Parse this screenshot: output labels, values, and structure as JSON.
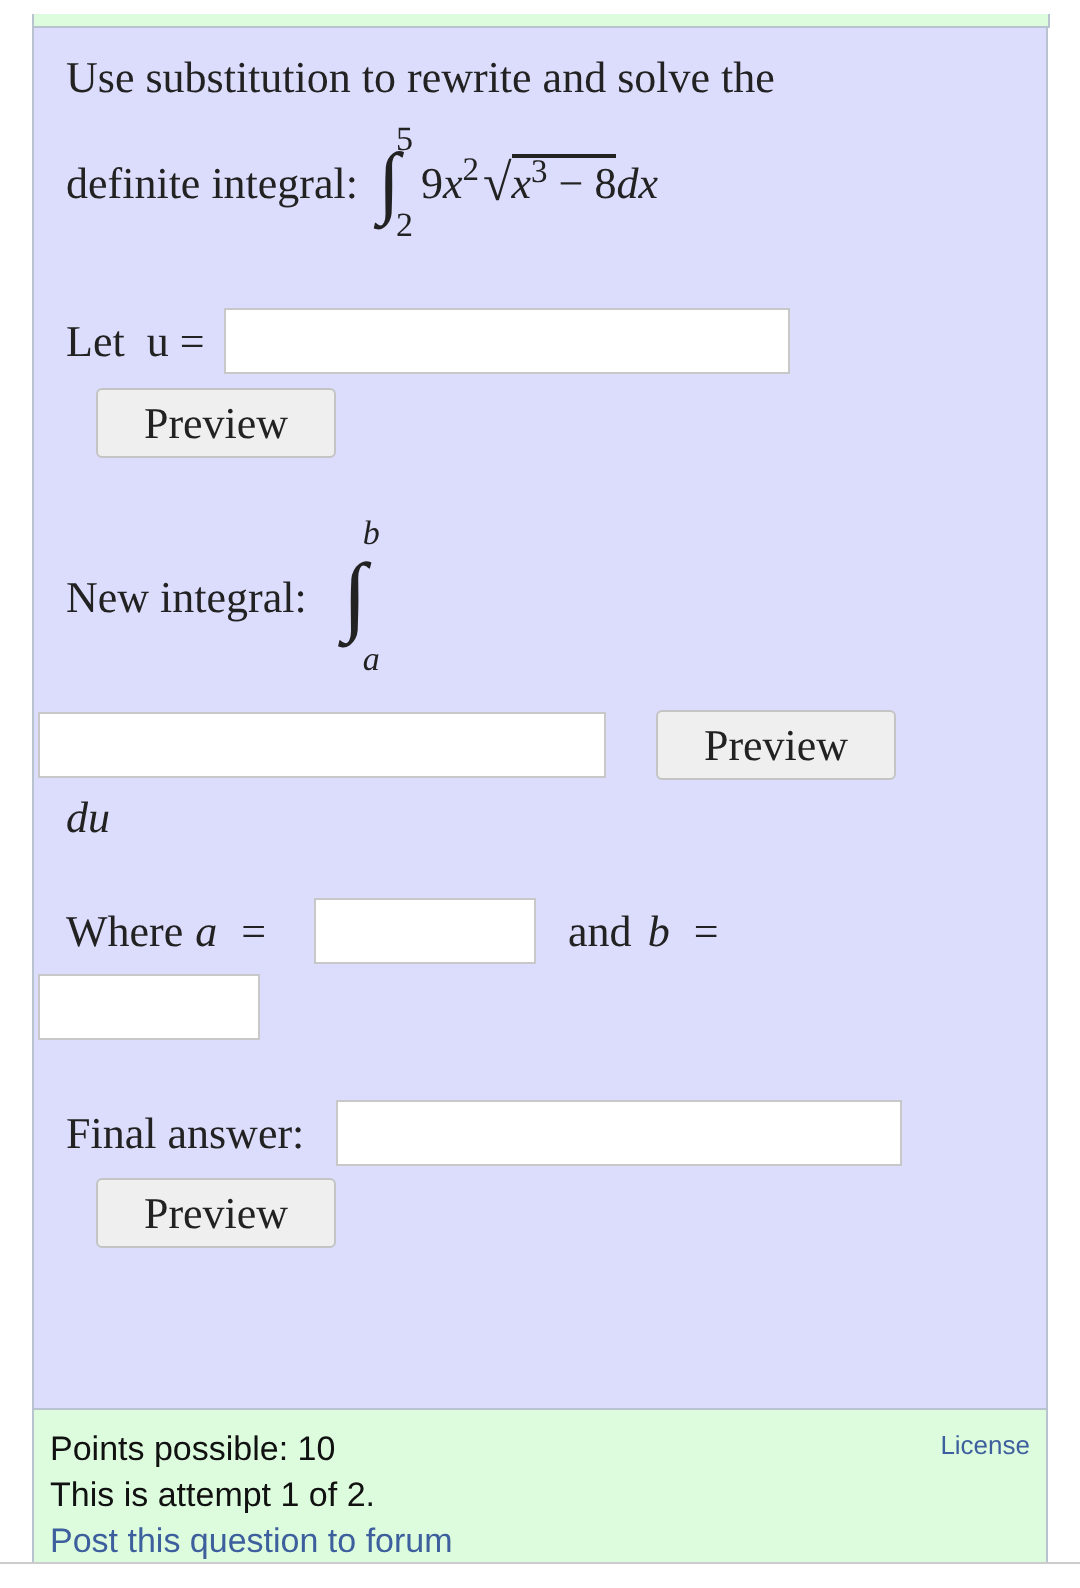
{
  "question": {
    "prompt_line1": "Use substitution to rewrite and solve the",
    "prompt_label": "definite integral:",
    "integral": {
      "sign": "∫",
      "upper": "5",
      "lower": "2",
      "coef": "9",
      "var": "x",
      "exp": "2",
      "radical": "√",
      "radicand_var": "x",
      "radicand_exp": "3",
      "radicand_rest": "− 8",
      "after_root": "dx"
    },
    "u_label": "Let  u =",
    "preview_1": "Preview",
    "new_integral_label": "New integral:",
    "new_integral": {
      "sign": "∫",
      "upper": "b",
      "lower": "a"
    },
    "preview_2": "Preview",
    "du": "du",
    "where_a": "Where",
    "a": "a",
    "eq": "=",
    "and_b": "and",
    "b": "b",
    "eq2": "=",
    "final_label": "Final answer:",
    "preview_3": "Preview"
  },
  "footer": {
    "points": "Points possible: 10",
    "attempt": "This is attempt 1 of 2.",
    "forum_link": "Post this question to forum",
    "license": "License"
  }
}
